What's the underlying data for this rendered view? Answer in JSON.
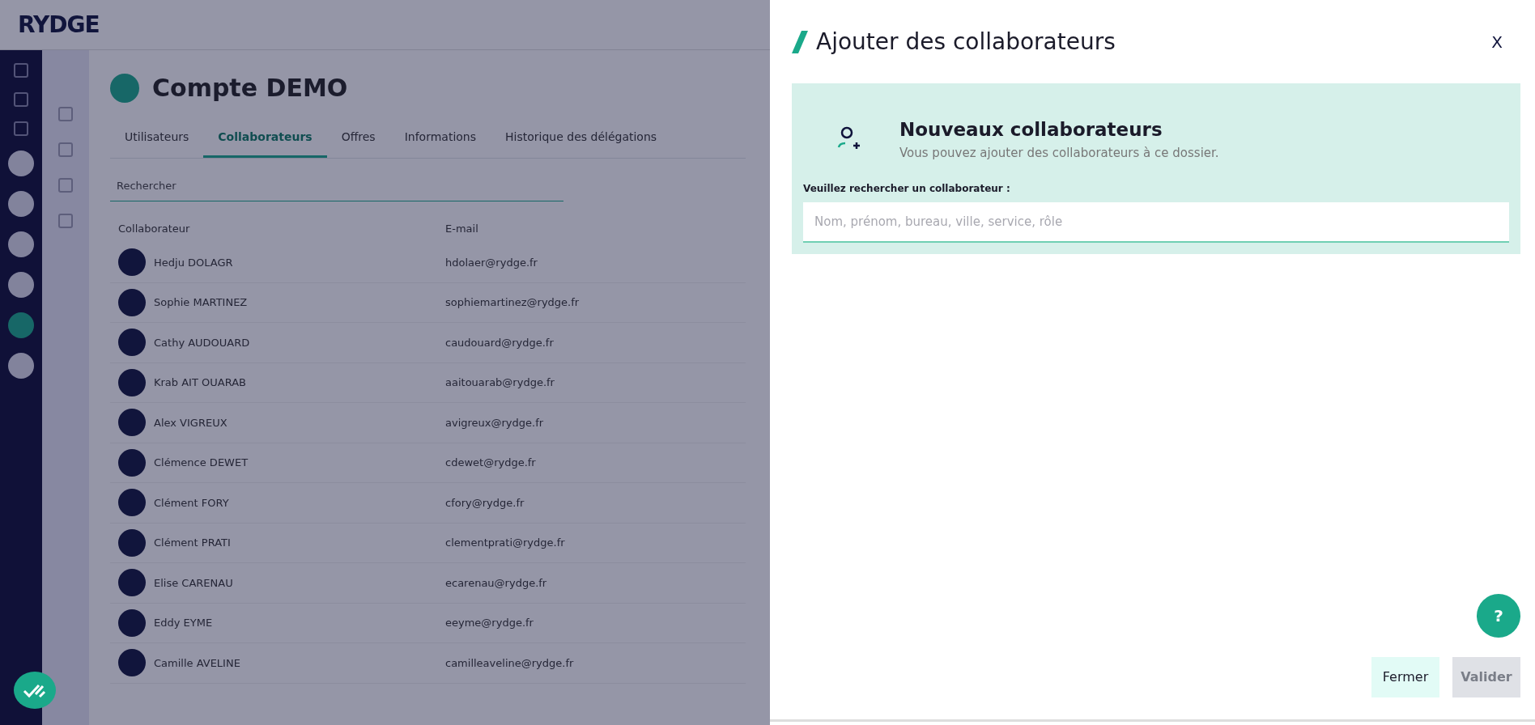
{
  "background_page": {
    "logo": "RYDGE",
    "account_title": "Compte DEMO",
    "tabs": [
      {
        "label": "Utilisateurs",
        "selected": false
      },
      {
        "label": "Collaborateurs",
        "selected": true
      },
      {
        "label": "Offres",
        "selected": false
      },
      {
        "label": "Informations",
        "selected": false
      },
      {
        "label": "Historique des délégations",
        "selected": false
      }
    ],
    "search": {
      "placeholder": "Rechercher"
    },
    "table": {
      "columns": [
        "Collaborateur",
        "E-mail"
      ],
      "rows": [
        {
          "name": "Hedju DOLAGR",
          "email": "hdolaer@rydge.fr"
        },
        {
          "name": "Sophie MARTINEZ",
          "email": "sophiemartinez@rydge.fr"
        },
        {
          "name": "Cathy AUDOUARD",
          "email": "caudouard@rydge.fr"
        },
        {
          "name": "Krab AIT OUARAB",
          "email": "aaitouarab@rydge.fr"
        },
        {
          "name": "Alex VIGREUX",
          "email": "avigreux@rydge.fr"
        },
        {
          "name": "Clémence DEWET",
          "email": "cdewet@rydge.fr"
        },
        {
          "name": "Clément FORY",
          "email": "cfory@rydge.fr"
        },
        {
          "name": "Clément PRATI",
          "email": "clementprati@rydge.fr"
        },
        {
          "name": "Elise CARENAU",
          "email": "ecarenau@rydge.fr"
        },
        {
          "name": "Eddy EYME",
          "email": "eeyme@rydge.fr"
        },
        {
          "name": "Camille AVELINE",
          "email": "camilleaveline@rydge.fr"
        }
      ]
    }
  },
  "panel": {
    "title": "Ajouter des collaborateurs",
    "close": "X",
    "info": {
      "heading": "Nouveaux collaborateurs",
      "text": "Vous pouvez ajouter des collaborateurs à ce dossier."
    },
    "search_label": "Veuillez rechercher un collaborateur :",
    "search": {
      "placeholder": "Nom, prénom, bureau, ville, service, rôle"
    },
    "help": "?",
    "buttons": [
      {
        "label": "Fermer",
        "kind": "secondary",
        "disabled": false
      },
      {
        "label": "Valider",
        "kind": "primary",
        "disabled": true
      }
    ]
  }
}
